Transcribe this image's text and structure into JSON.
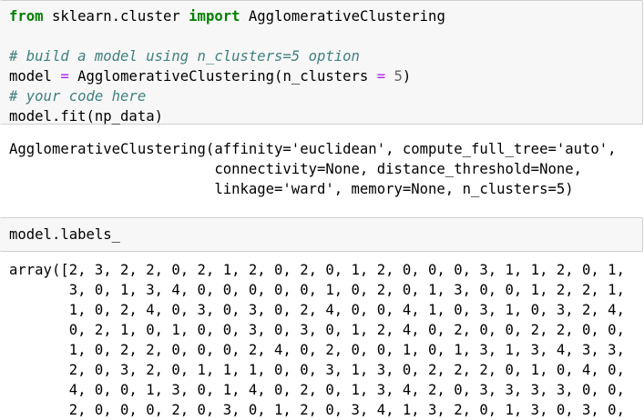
{
  "cell1": {
    "import_from": "from",
    "import_module": " sklearn.cluster ",
    "import_kw": "import",
    "import_name": " AgglomerativeClustering",
    "comment_build": "# build a model using n_clusters=5 option",
    "assign_var": "model ",
    "assign_op": "=",
    "assign_call": " AgglomerativeClustering(n_clusters ",
    "assign_op2": "=",
    "assign_space": " ",
    "assign_num": "5",
    "assign_close": ")",
    "comment_code": "# your code here",
    "fit_line": "model.fit(np_data)"
  },
  "output1": {
    "lines": [
      "AgglomerativeClustering(affinity='euclidean', compute_full_tree='auto',",
      "                        connectivity=None, distance_threshold=None,",
      "                        linkage='ward', memory=None, n_clusters=5)"
    ]
  },
  "cell2": {
    "code": "model.labels_"
  },
  "output2": {
    "lines": [
      "array([2, 3, 2, 2, 0, 2, 1, 2, 0, 2, 0, 1, 2, 0, 0, 0, 3, 1, 1, 2, 0, 1,",
      "       3, 0, 1, 3, 4, 0, 0, 0, 0, 0, 1, 0, 2, 0, 1, 3, 0, 0, 1, 2, 2, 1,",
      "       1, 0, 2, 4, 0, 3, 0, 3, 0, 2, 4, 0, 0, 4, 1, 0, 3, 1, 0, 3, 2, 4,",
      "       0, 2, 1, 0, 1, 0, 0, 3, 0, 3, 0, 1, 2, 4, 0, 2, 0, 0, 2, 2, 0, 0,",
      "       1, 0, 2, 2, 0, 0, 0, 2, 4, 0, 2, 0, 0, 1, 0, 1, 3, 1, 3, 4, 3, 3,",
      "       2, 0, 3, 2, 0, 1, 1, 1, 0, 0, 3, 1, 3, 0, 2, 2, 2, 0, 1, 0, 4, 0,",
      "       4, 0, 0, 1, 3, 0, 1, 4, 0, 2, 0, 1, 3, 4, 2, 0, 3, 3, 3, 3, 0, 0,",
      "       2, 0, 0, 0, 2, 0, 3, 0, 1, 2, 0, 3, 4, 1, 3, 2, 0, 1, 3, 0, 3, 0,"
    ]
  }
}
